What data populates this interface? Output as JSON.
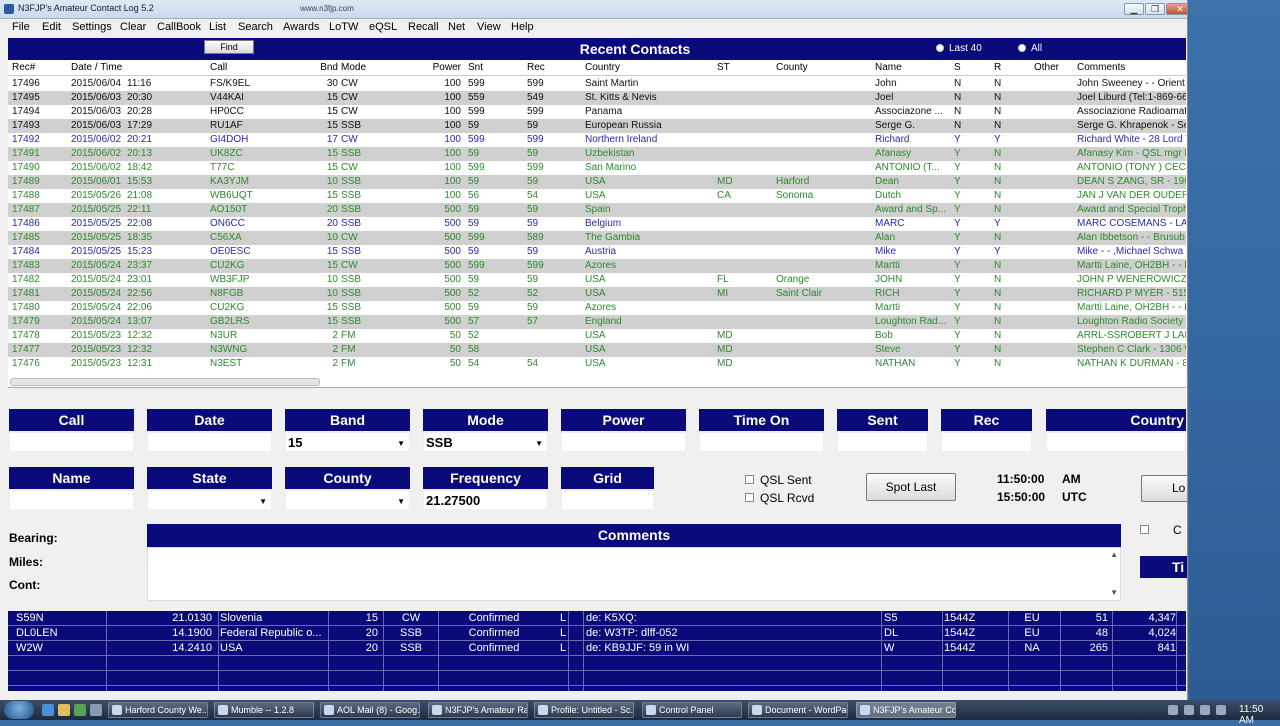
{
  "window": {
    "title": "N3FJP's Amateur Contact Log 5.2",
    "url": "www.n3fjp.com",
    "minimize_label": "▁",
    "maximize_label": "❐",
    "close_label": "✕"
  },
  "menu": [
    "File",
    "Edit",
    "Settings",
    "Clear",
    "CallBook",
    "List",
    "Search",
    "Awards",
    "LoTW",
    "eQSL",
    "Recall",
    "Net",
    "View",
    "Help"
  ],
  "recent": {
    "find_label": "Find",
    "title": "Recent Contacts",
    "radio_last": "Last 40",
    "radio_all": "All"
  },
  "grid": {
    "columns": [
      "Rec#",
      "Date  /  Time",
      "Call",
      "Bnd",
      "Mode",
      "Power",
      "Snt",
      "Rec",
      "Country",
      "ST",
      "County",
      "Name",
      "S",
      "R",
      "Other",
      "Comments"
    ],
    "rows": [
      {
        "rec": "17496",
        "date": "2015/06/04",
        "time": "11:16",
        "call": "FS/K9EL",
        "bnd": "30",
        "mode": "CW",
        "power": "100",
        "snt": "599",
        "rcv": "599",
        "country": "Saint Martin",
        "st": "",
        "county": "",
        "name": "John",
        "s": "N",
        "r": "N",
        "other": "",
        "comments": "John Sweeney -  - Orient",
        "color": "black"
      },
      {
        "rec": "17495",
        "date": "2015/06/03",
        "time": "20:30",
        "call": "V44KAI",
        "bnd": "15",
        "mode": "CW",
        "power": "100",
        "snt": "559",
        "rcv": "549",
        "country": "St. Kitts & Nevis",
        "st": "",
        "county": "",
        "name": "Joel",
        "s": "N",
        "r": "N",
        "other": "",
        "comments": "Joel Liburd (Tel:1-869-66",
        "color": "black"
      },
      {
        "rec": "17494",
        "date": "2015/06/03",
        "time": "20:28",
        "call": "HP0CC",
        "bnd": "15",
        "mode": "CW",
        "power": "100",
        "snt": "599",
        "rcv": "599",
        "country": "Panama",
        "st": "",
        "county": "",
        "name": "Associazone ...",
        "s": "N",
        "r": "N",
        "other": "",
        "comments": "Associazione Radioamat",
        "color": "black"
      },
      {
        "rec": "17493",
        "date": "2015/06/03",
        "time": "17:29",
        "call": "RU1AF",
        "bnd": "15",
        "mode": "SSB",
        "power": "100",
        "snt": "59",
        "rcv": "59",
        "country": "European Russia",
        "st": "",
        "county": "",
        "name": "Serge G.",
        "s": "N",
        "r": "N",
        "other": "",
        "comments": "Serge G. Khrapenok - Se",
        "color": "black"
      },
      {
        "rec": "17492",
        "date": "2015/06/02",
        "time": "20:21",
        "call": "GI4DOH",
        "bnd": "17",
        "mode": "CW",
        "power": "100",
        "snt": "599",
        "rcv": "599",
        "country": "Northern Ireland",
        "st": "",
        "county": "",
        "name": "Richard",
        "s": "Y",
        "r": "Y",
        "other": "",
        "comments": "Richard White - 28 Lord V",
        "color": "blue"
      },
      {
        "rec": "17491",
        "date": "2015/06/02",
        "time": "20:13",
        "call": "UK8ZC",
        "bnd": "15",
        "mode": "SSB",
        "power": "100",
        "snt": "59",
        "rcv": "59",
        "country": "Uzbekistan",
        "st": "",
        "county": "",
        "name": "Afanasy",
        "s": "Y",
        "r": "N",
        "other": "",
        "comments": "Afanasy Kim - QSL mgr I",
        "color": "green"
      },
      {
        "rec": "17490",
        "date": "2015/06/02",
        "time": "18:42",
        "call": "T77C",
        "bnd": "15",
        "mode": "CW",
        "power": "100",
        "snt": "599",
        "rcv": "599",
        "country": "San Marino",
        "st": "",
        "county": "",
        "name": "ANTONIO (T...",
        "s": "Y",
        "r": "N",
        "other": "",
        "comments": "ANTONIO (TONY ) CECC",
        "color": "green"
      },
      {
        "rec": "17489",
        "date": "2015/06/01",
        "time": "15:53",
        "call": "KA3YJM",
        "bnd": "10",
        "mode": "SSB",
        "power": "100",
        "snt": "59",
        "rcv": "59",
        "country": "USA",
        "st": "MD",
        "county": "Harford",
        "name": "Dean",
        "s": "Y",
        "r": "N",
        "other": "",
        "comments": "DEAN S ZANG, SR - 196",
        "color": "green"
      },
      {
        "rec": "17488",
        "date": "2015/05/26",
        "time": "21:08",
        "call": "WB6UQT",
        "bnd": "15",
        "mode": "SSB",
        "power": "100",
        "snt": "56",
        "rcv": "54",
        "country": "USA",
        "st": "CA",
        "county": "Sonoma",
        "name": "Dutch",
        "s": "Y",
        "r": "N",
        "other": "",
        "comments": "JAN J VAN DER OUDER",
        "color": "green"
      },
      {
        "rec": "17487",
        "date": "2015/05/25",
        "time": "22:11",
        "call": "AO150T",
        "bnd": "20",
        "mode": "SSB",
        "power": "500",
        "snt": "59",
        "rcv": "59",
        "country": "Spain",
        "st": "",
        "county": "",
        "name": "Award and Sp...",
        "s": "Y",
        "r": "N",
        "other": "",
        "comments": "Award and Special Troph",
        "color": "green"
      },
      {
        "rec": "17486",
        "date": "2015/05/25",
        "time": "22:08",
        "call": "ON6CC",
        "bnd": "20",
        "mode": "SSB",
        "power": "500",
        "snt": "59",
        "rcv": "59",
        "country": "Belgium",
        "st": "",
        "county": "",
        "name": "MARC",
        "s": "Y",
        "r": "Y",
        "other": "",
        "comments": "MARC COSEMANS - LAI",
        "color": "blue"
      },
      {
        "rec": "17485",
        "date": "2015/05/25",
        "time": "18:35",
        "call": "C56XA",
        "bnd": "10",
        "mode": "CW",
        "power": "500",
        "snt": "599",
        "rcv": "589",
        "country": "The Gambia",
        "st": "",
        "county": "",
        "name": "Alan",
        "s": "Y",
        "r": "N",
        "other": "",
        "comments": "Alan Ibbetson -  - Brusub",
        "color": "green"
      },
      {
        "rec": "17484",
        "date": "2015/05/25",
        "time": "15:23",
        "call": "OE0ESC",
        "bnd": "15",
        "mode": "SSB",
        "power": "500",
        "snt": "59",
        "rcv": "59",
        "country": "Austria",
        "st": "",
        "county": "",
        "name": "Mike",
        "s": "Y",
        "r": "Y",
        "other": "",
        "comments": "Mike -  - ,Michael Schwa",
        "color": "blue"
      },
      {
        "rec": "17483",
        "date": "2015/05/24",
        "time": "23:37",
        "call": "CU2KG",
        "bnd": "15",
        "mode": "CW",
        "power": "500",
        "snt": "599",
        "rcv": "599",
        "country": "Azores",
        "st": "",
        "county": "",
        "name": "Martti",
        "s": "Y",
        "r": "N",
        "other": "",
        "comments": "Martti Laine, OH2BH -  - F",
        "color": "green"
      },
      {
        "rec": "17482",
        "date": "2015/05/24",
        "time": "23:01",
        "call": "WB3FJP",
        "bnd": "10",
        "mode": "SSB",
        "power": "500",
        "snt": "59",
        "rcv": "59",
        "country": "USA",
        "st": "FL",
        "county": "Orange",
        "name": "JOHN",
        "s": "Y",
        "r": "N",
        "other": "",
        "comments": "JOHN P WENEROWICZ",
        "color": "green"
      },
      {
        "rec": "17481",
        "date": "2015/05/24",
        "time": "22:56",
        "call": "N8FGB",
        "bnd": "10",
        "mode": "SSB",
        "power": "500",
        "snt": "52",
        "rcv": "52",
        "country": "USA",
        "st": "MI",
        "county": "Saint Clair",
        "name": "RICH",
        "s": "Y",
        "r": "N",
        "other": "",
        "comments": "RICHARD P MYER - 515",
        "color": "green"
      },
      {
        "rec": "17480",
        "date": "2015/05/24",
        "time": "22:06",
        "call": "CU2KG",
        "bnd": "15",
        "mode": "SSB",
        "power": "500",
        "snt": "59",
        "rcv": "59",
        "country": "Azores",
        "st": "",
        "county": "",
        "name": "Martti",
        "s": "Y",
        "r": "N",
        "other": "",
        "comments": "Martti Laine, OH2BH -  - F",
        "color": "green"
      },
      {
        "rec": "17479",
        "date": "2015/05/24",
        "time": "13:07",
        "call": "GB2LRS",
        "bnd": "15",
        "mode": "SSB",
        "power": "500",
        "snt": "57",
        "rcv": "57",
        "country": "England",
        "st": "",
        "county": "",
        "name": "Loughton Rad...",
        "s": "Y",
        "r": "N",
        "other": "",
        "comments": "Loughton Radio Society",
        "color": "green"
      },
      {
        "rec": "17478",
        "date": "2015/05/23",
        "time": "12:32",
        "call": "N3UR",
        "bnd": "2",
        "mode": "FM",
        "power": "50",
        "snt": "52",
        "rcv": "",
        "country": "USA",
        "st": "MD",
        "county": "",
        "name": "Bob",
        "s": "Y",
        "r": "N",
        "other": "",
        "comments": "ARRL-SSROBERT J LAM",
        "color": "green"
      },
      {
        "rec": "17477",
        "date": "2015/05/23",
        "time": "12:32",
        "call": "N3WNG",
        "bnd": "2",
        "mode": "FM",
        "power": "50",
        "snt": "58",
        "rcv": "",
        "country": "USA",
        "st": "MD",
        "county": "",
        "name": "Steve",
        "s": "Y",
        "r": "N",
        "other": "",
        "comments": "Stephen C Clark - 1306 W",
        "color": "green"
      },
      {
        "rec": "17476",
        "date": "2015/05/23",
        "time": "12:31",
        "call": "N3EST",
        "bnd": "2",
        "mode": "FM",
        "power": "50",
        "snt": "54",
        "rcv": "54",
        "country": "USA",
        "st": "MD",
        "county": "",
        "name": "NATHAN",
        "s": "Y",
        "r": "N",
        "other": "",
        "comments": "NATHAN K DURMAN - 8",
        "color": "green"
      }
    ]
  },
  "entry": {
    "call_label": "Call",
    "date_label": "Date",
    "band_label": "Band",
    "band_value": "15",
    "mode_label": "Mode",
    "mode_value": "SSB",
    "power_label": "Power",
    "timeon_label": "Time On",
    "sent_label": "Sent",
    "rec_label": "Rec",
    "country_label": "Country",
    "name_label": "Name",
    "state_label": "State",
    "county_label": "County",
    "frequency_label": "Frequency",
    "frequency_value": "21.27500",
    "grid_label": "Grid",
    "qsl_sent": "QSL Sent",
    "qsl_rcvd": "QSL Rcvd",
    "spot_last": "Spot Last",
    "local_time": "11:50:00",
    "local_suffix": "AM",
    "utc_time": "15:50:00",
    "utc_suffix": "UTC",
    "log_button": "Lo",
    "bearing_label": "Bearing:",
    "miles_label": "Miles:",
    "cont_label": "Cont:",
    "comments_label": "Comments",
    "side_check": "C",
    "side_btn": "Ti"
  },
  "spots": [
    {
      "call": "S59N",
      "freq": "21.0130",
      "country": "Slovenia",
      "band": "15",
      "mode": "CW",
      "status": "Confirmed",
      "flag": "L",
      "comment": "de: K5XQ:",
      "pfx": "S5",
      "time": "1544Z",
      "cont": "EU",
      "num": "51",
      "dist": "4,347"
    },
    {
      "call": "DL0LEN",
      "freq": "14.1900",
      "country": "Federal Republic o...",
      "band": "20",
      "mode": "SSB",
      "status": "Confirmed",
      "flag": "L",
      "comment": "de: W3TP: dlff-052",
      "pfx": "DL",
      "time": "1544Z",
      "cont": "EU",
      "num": "48",
      "dist": "4,024"
    },
    {
      "call": "W2W",
      "freq": "14.2410",
      "country": "USA",
      "band": "20",
      "mode": "SSB",
      "status": "Confirmed",
      "flag": "L",
      "comment": "de: KB9JJF: 59 in WI",
      "pfx": "W",
      "time": "1544Z",
      "cont": "NA",
      "num": "265",
      "dist": "841"
    }
  ],
  "taskbar": {
    "tasks": [
      "Harford County We...",
      "Mumble -- 1.2.8",
      "AOL Mail (8) - Goog...",
      "N3FJP's Amateur Ra...",
      "Profile: Untitled - Sc...",
      "Control Panel",
      "Document - WordPad",
      "N3FJP's Amateur Co..."
    ],
    "clock": "11:50 AM"
  },
  "colors": {
    "header_navy": "#0a0a7a",
    "row_blue": "#2a2ab0",
    "row_green": "#2d8a2d",
    "desktop": "#3a6ea5"
  }
}
